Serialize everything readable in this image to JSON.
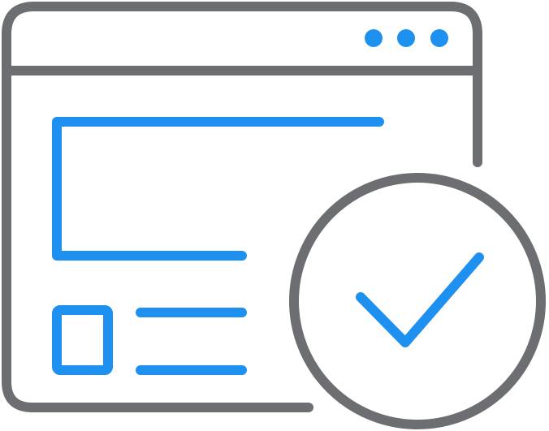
{
  "illustration": {
    "icons": {
      "window": "browser-window-icon",
      "menu_dots": "more-dots-icon",
      "content_frame": "content-frame-icon",
      "thumbnail": "image-thumbnail-icon",
      "text_lines": "text-lines-icon",
      "verified_badge": "checkmark-circle-icon"
    },
    "colors": {
      "outline": "#6D6E71",
      "accent": "#1E90F0",
      "background": "#FFFFFF"
    }
  }
}
